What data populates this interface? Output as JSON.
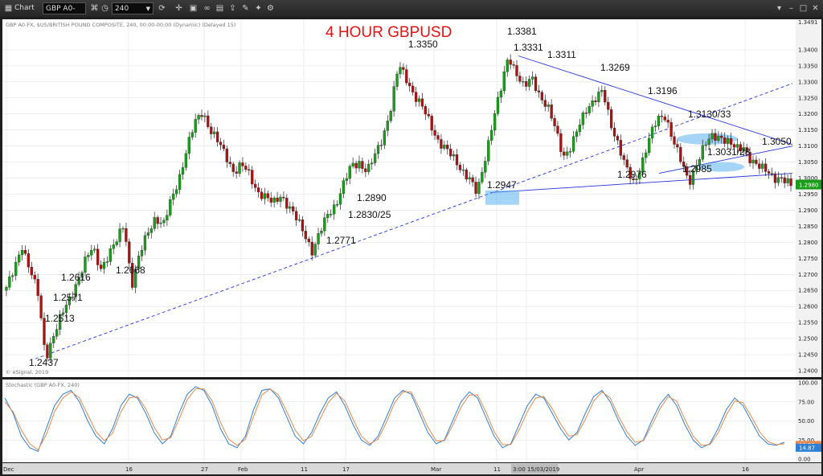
{
  "toolbar": {
    "app_label": "Chart",
    "symbol": "GBP A0-FX",
    "interval": "240"
  },
  "header": {
    "description": "GBP A0-FX, $US/BRITISH POUND COMPOSITE, 240, 00:00-00:00 (Dynamic) (Delayed 15)",
    "source": "© eSignal, 2019",
    "stoch_label": "Stochastic (GBP A0-FX, 240)"
  },
  "chart_data": [
    {
      "type": "candlestick",
      "title": "4 HOUR GBPUSD",
      "ylim": [
        1.238,
        1.3495
      ],
      "y_ticks": [
        "1.2400",
        "1.2450",
        "1.2500",
        "1.2550",
        "1.2600",
        "1.2650",
        "1.2700",
        "1.2750",
        "1.2800",
        "1.2850",
        "1.2900",
        "1.2950",
        "1.3000",
        "1.3050",
        "1.3100",
        "1.3150",
        "1.3200",
        "1.3250",
        "1.3300",
        "1.3350",
        "1.3400"
      ],
      "x_ticks": [
        "Dec",
        "16",
        "27",
        "Feb",
        "11",
        "17",
        "Mar",
        "11",
        "15/03/2019",
        "Apr",
        "16"
      ],
      "crosshair_time": "3:00 15/03/2019",
      "last_price": "1.2980",
      "top_price": "1.3491",
      "up_color": "#1a9e1a",
      "down_color": "#b01010",
      "path": [
        1.266,
        1.271,
        1.279,
        1.272,
        1.264,
        1.2437,
        1.2513,
        1.2571,
        1.2616,
        1.268,
        1.274,
        1.278,
        1.272,
        1.276,
        1.28,
        1.286,
        1.2668,
        1.276,
        1.283,
        1.288,
        1.285,
        1.293,
        1.3,
        1.309,
        1.317,
        1.321,
        1.315,
        1.311,
        1.307,
        1.302,
        1.304,
        1.301,
        1.296,
        1.294,
        1.292,
        1.295,
        1.291,
        1.287,
        1.283,
        1.2771,
        1.283,
        1.289,
        1.292,
        1.298,
        1.304,
        1.305,
        1.302,
        1.307,
        1.313,
        1.322,
        1.335,
        1.331,
        1.326,
        1.322,
        1.317,
        1.312,
        1.309,
        1.306,
        1.303,
        1.3,
        1.2947,
        1.306,
        1.318,
        1.327,
        1.3381,
        1.3331,
        1.328,
        1.3311,
        1.326,
        1.322,
        1.315,
        1.307,
        1.31,
        1.316,
        1.322,
        1.325,
        1.3269,
        1.317,
        1.311,
        1.303,
        1.2976,
        1.305,
        1.313,
        1.318,
        1.3196,
        1.312,
        1.305,
        1.2985,
        1.305,
        1.31,
        1.313,
        1.3133,
        1.311,
        1.309,
        1.31,
        1.305,
        1.3031,
        1.3028,
        1.3,
        1.299,
        1.298
      ],
      "annotations": [
        "1.2437",
        "1.2513",
        "1.2571",
        "1.2616",
        "1.2668",
        "1.2771",
        "1.2830/25",
        "1.2890",
        "1.3350",
        "1.2947",
        "1.3381",
        "1.3331",
        "1.3311",
        "1.3269",
        "1.2976",
        "1.3196",
        "1.2985",
        "1.3130/33",
        "1.3031/28",
        "1.3050"
      ]
    },
    {
      "type": "line",
      "name": "stochastic",
      "ylim": [
        0,
        100
      ],
      "y_ticks": [
        "100.00",
        "75.00",
        "50.00",
        "25.00",
        "0.00"
      ],
      "last_values": [
        "18.50",
        "14.87"
      ],
      "series": [
        {
          "color": "#2f7fd6",
          "values": [
            80,
            60,
            30,
            15,
            10,
            40,
            70,
            85,
            90,
            75,
            50,
            30,
            20,
            40,
            70,
            85,
            80,
            60,
            35,
            20,
            30,
            60,
            85,
            95,
            90,
            70,
            40,
            20,
            15,
            30,
            65,
            90,
            92,
            80,
            55,
            30,
            20,
            35,
            60,
            80,
            88,
            70,
            45,
            25,
            18,
            30,
            55,
            80,
            90,
            85,
            60,
            35,
            20,
            25,
            50,
            75,
            88,
            80,
            55,
            30,
            15,
            20,
            45,
            70,
            85,
            80,
            60,
            40,
            25,
            35,
            60,
            82,
            90,
            75,
            50,
            30,
            18,
            25,
            50,
            72,
            85,
            70,
            45,
            25,
            15,
            20,
            40,
            65,
            80,
            70,
            50,
            30,
            20,
            18,
            22
          ]
        },
        {
          "color": "#e8884a",
          "values": [
            75,
            62,
            38,
            20,
            12,
            32,
            62,
            80,
            88,
            80,
            58,
            36,
            24,
            34,
            62,
            80,
            82,
            66,
            42,
            25,
            28,
            52,
            78,
            92,
            92,
            76,
            48,
            26,
            18,
            26,
            56,
            84,
            92,
            84,
            62,
            38,
            24,
            30,
            52,
            74,
            86,
            76,
            52,
            30,
            20,
            26,
            48,
            74,
            88,
            88,
            66,
            42,
            24,
            24,
            44,
            68,
            84,
            84,
            62,
            36,
            19,
            19,
            38,
            62,
            80,
            82,
            66,
            46,
            30,
            32,
            52,
            76,
            88,
            80,
            56,
            36,
            22,
            24,
            44,
            66,
            82,
            76,
            52,
            30,
            18,
            19,
            34,
            58,
            76,
            74,
            56,
            36,
            23,
            19,
            20
          ]
        }
      ]
    }
  ],
  "colors": {
    "chart_bg": "#ffffff",
    "frame": "#1e1e1e",
    "grid": "#e2e2e2",
    "trend_line": "#2233dd",
    "highlight": "#5ab0ee"
  }
}
